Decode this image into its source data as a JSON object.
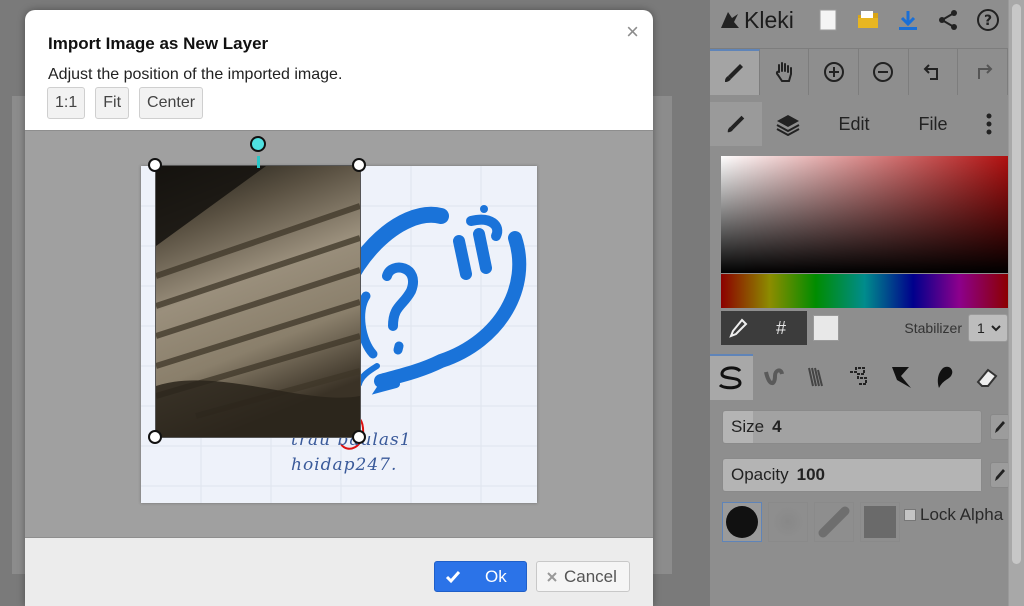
{
  "app": {
    "name": "Kleki"
  },
  "dialog": {
    "title": "Import Image as New Layer",
    "description": "Adjust the position of the imported image.",
    "buttons": {
      "one_to_one": "1:1",
      "fit": "Fit",
      "center": "Center"
    },
    "ok_label": "Ok",
    "cancel_label": "Cancel",
    "close_glyph": "×"
  },
  "imported_note": {
    "line1": "trau baulas1",
    "line2": "hoidap247."
  },
  "panel": {
    "tabs": {
      "edit": "Edit",
      "file": "File"
    },
    "color": {
      "hash_glyph": "#"
    },
    "stabilizer": {
      "label": "Stabilizer",
      "value": "1"
    },
    "size": {
      "label": "Size",
      "value": "4"
    },
    "opacity": {
      "label": "Opacity",
      "value": "100"
    },
    "lock_alpha": {
      "label": "Lock Alpha",
      "checked": false
    }
  },
  "colors": {
    "accent": "#2b73e8",
    "rotate_handle": "#4fe0e0",
    "blue_ink": "#1a73d9",
    "panel_bg": "#8e8e8e"
  },
  "icons": [
    "kleki-logo-icon",
    "new-file-icon",
    "folder-icon",
    "download-icon",
    "share-icon",
    "help-icon",
    "brush-icon",
    "hand-icon",
    "zoom-in-icon",
    "zoom-out-icon",
    "undo-icon",
    "redo-icon",
    "layers-icon",
    "more-icon",
    "eyedropper-icon",
    "pen-pressure-icon",
    "checkmark-icon",
    "close-icon"
  ]
}
